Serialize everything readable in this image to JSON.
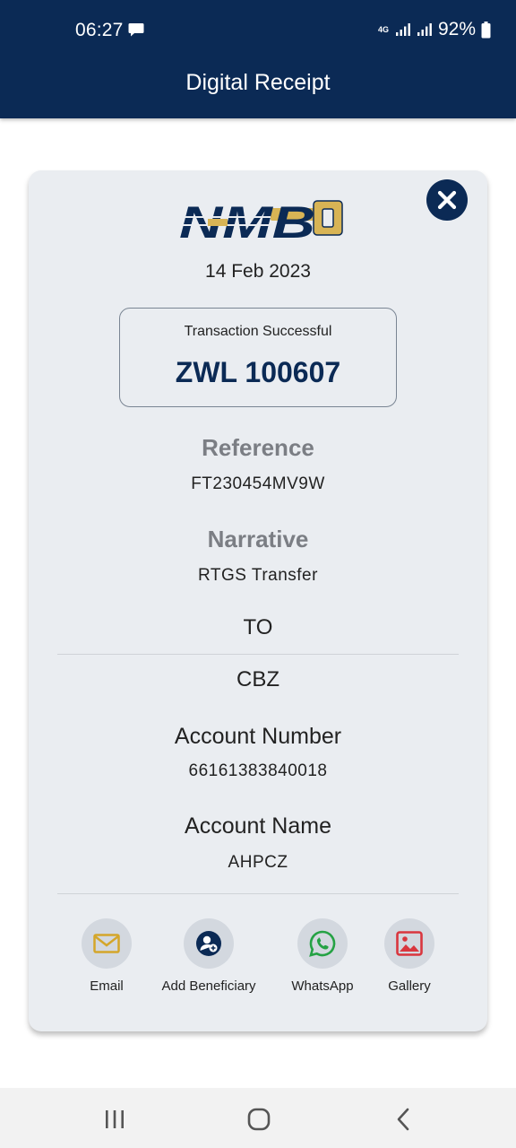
{
  "status_bar": {
    "time": "06:27",
    "network": "4G",
    "battery": "92%"
  },
  "app_bar": {
    "title": "Digital Receipt"
  },
  "receipt": {
    "logo_text": "NMB",
    "date": "14 Feb 2023",
    "status": "Transaction Successful",
    "amount": "ZWL 100607",
    "reference_title": "Reference",
    "reference_value": "FT230454MV9W",
    "narrative_title": "Narrative",
    "narrative_value": "RTGS Transfer",
    "to_label": "TO",
    "bank": "CBZ",
    "account_number_title": "Account Number",
    "account_number_value": "66161383840018",
    "account_name_title": "Account Name",
    "account_name_value": "AHPCZ"
  },
  "actions": [
    {
      "label": "Email",
      "icon": "email-icon",
      "color": "#d4a62a"
    },
    {
      "label": "Add Beneficiary",
      "icon": "add-user-icon",
      "color": "#0b2a55"
    },
    {
      "label": "WhatsApp",
      "icon": "whatsapp-icon",
      "color": "#25a244"
    },
    {
      "label": "Gallery",
      "icon": "gallery-icon",
      "color": "#d9363e"
    }
  ],
  "colors": {
    "primary": "#0b2a55",
    "card_background": "#eaedf1",
    "logo_gold": "#d8b455"
  }
}
